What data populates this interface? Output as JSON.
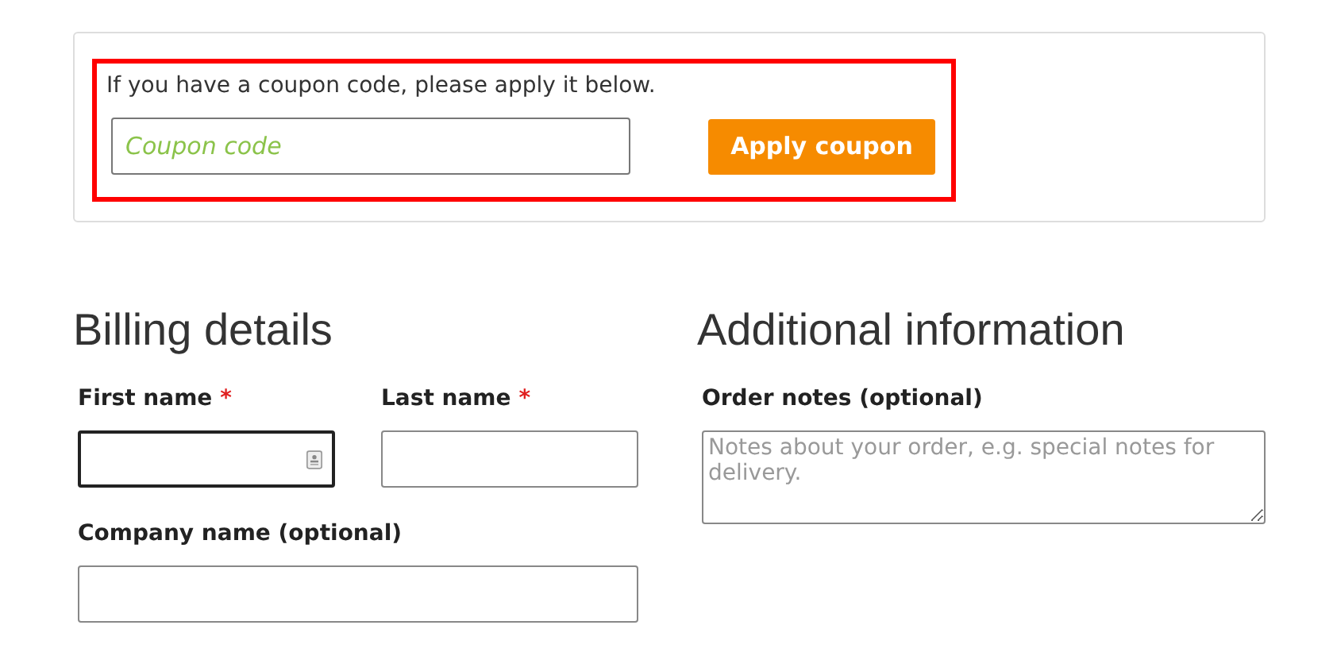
{
  "coupon": {
    "highlighted": true,
    "message": "If you have a coupon code, please apply it below.",
    "placeholder": "Coupon code",
    "button": "Apply coupon"
  },
  "billing": {
    "title": "Billing details",
    "rows": [
      [
        {
          "label": "First name",
          "required_mark": "*",
          "focused": true
        },
        {
          "label": "Last name",
          "required_mark": "*",
          "focused": false
        }
      ],
      [
        {
          "label": "Company name (optional)",
          "focused": false
        }
      ]
    ]
  },
  "additional": {
    "title": "Additional information",
    "notes": {
      "label": "Order notes (optional)",
      "placeholder": "Notes about your order, e.g. special notes for delivery."
    }
  }
}
